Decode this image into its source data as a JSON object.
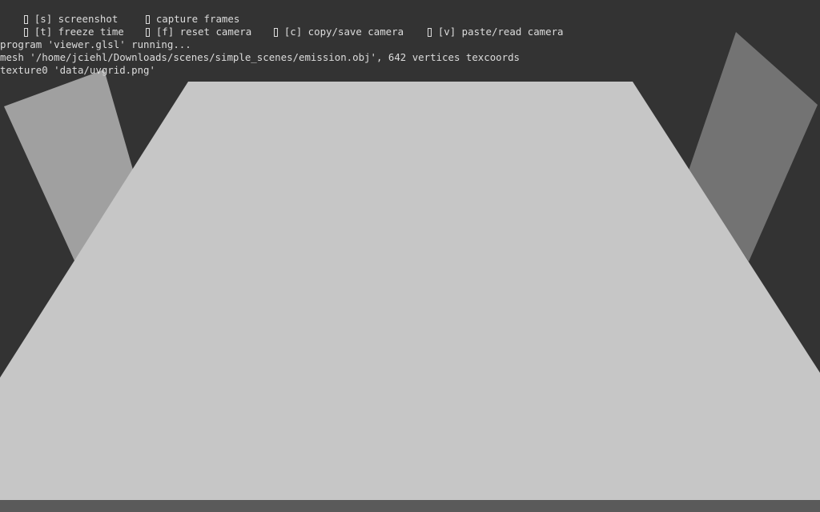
{
  "scene": {
    "background": "#333333",
    "floor_color": "#c6c6c6",
    "left_light_color": "#a0a0a0",
    "right_light_color": "#737373",
    "bottom_edge_color": "#5a5a5a"
  },
  "controls": {
    "screenshot": "[s] screenshot",
    "capture_frames": "capture frames",
    "freeze_time": "[t] freeze time",
    "reset_camera": "[f] reset camera",
    "copy_save_camera": "[c] copy/save camera",
    "paste_read_camera": "[v] paste/read camera"
  },
  "log": {
    "line1": "program 'viewer.glsl' running...",
    "line2": "mesh '/home/jciehl/Downloads/scenes/simple_scenes/emission.obj', 642 vertices texcoords",
    "line3": "texture0 'data/uvgrid.png'"
  }
}
